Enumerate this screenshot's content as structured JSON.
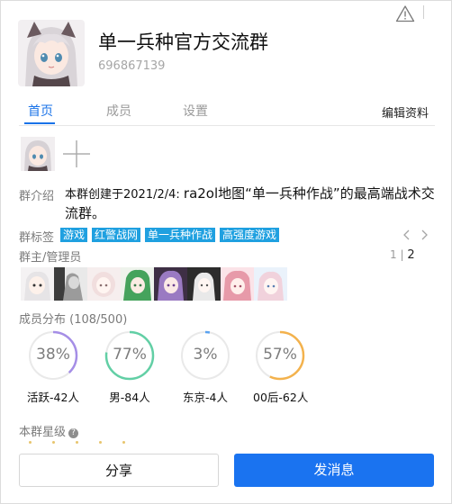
{
  "header": {
    "title": "单一兵种官方交流群",
    "group_id": "696867139"
  },
  "tabs": [
    {
      "label": "首页",
      "active": true
    },
    {
      "label": "成员",
      "active": false
    },
    {
      "label": "设置",
      "active": false
    }
  ],
  "edit_label": "编辑资料",
  "intro": {
    "label": "群介绍",
    "text_prefix": "本群创建于2021/2/4: ",
    "text_main": "ra2ol地图“单一兵种作战”的最高端战术交流群。"
  },
  "tags": {
    "label": "群标签",
    "items": [
      "游戏",
      "红警战网",
      "单一兵种作战",
      "高强度游戏"
    ],
    "color": "#1fa0e0"
  },
  "admins": {
    "label": "群主/管理员",
    "page_current": "1",
    "page_total": "2",
    "count_shown": 8
  },
  "distribution": {
    "label": "成员分布 (108/500)",
    "stats": [
      {
        "pct_label": "38%",
        "value": 0.38,
        "caption": "活跃-42人",
        "color": "#a58ee6"
      },
      {
        "pct_label": "77%",
        "value": 0.77,
        "caption": "男-84人",
        "color": "#62cfa5"
      },
      {
        "pct_label": "3%",
        "value": 0.03,
        "caption": "东京-4人",
        "color": "#5aa2f0"
      },
      {
        "pct_label": "57%",
        "value": 0.57,
        "caption": "00后-62人",
        "color": "#f3b24d"
      }
    ]
  },
  "level": {
    "label": "本群星级",
    "help_glyph": "?"
  },
  "buttons": {
    "share": "分享",
    "send": "发消息"
  },
  "colors": {
    "accent": "#1a73e8",
    "send_button": "#1a73f0"
  },
  "icons": [
    "warning-icon",
    "add-photo-icon",
    "chevron-left-icon",
    "chevron-right-icon",
    "help-icon"
  ]
}
